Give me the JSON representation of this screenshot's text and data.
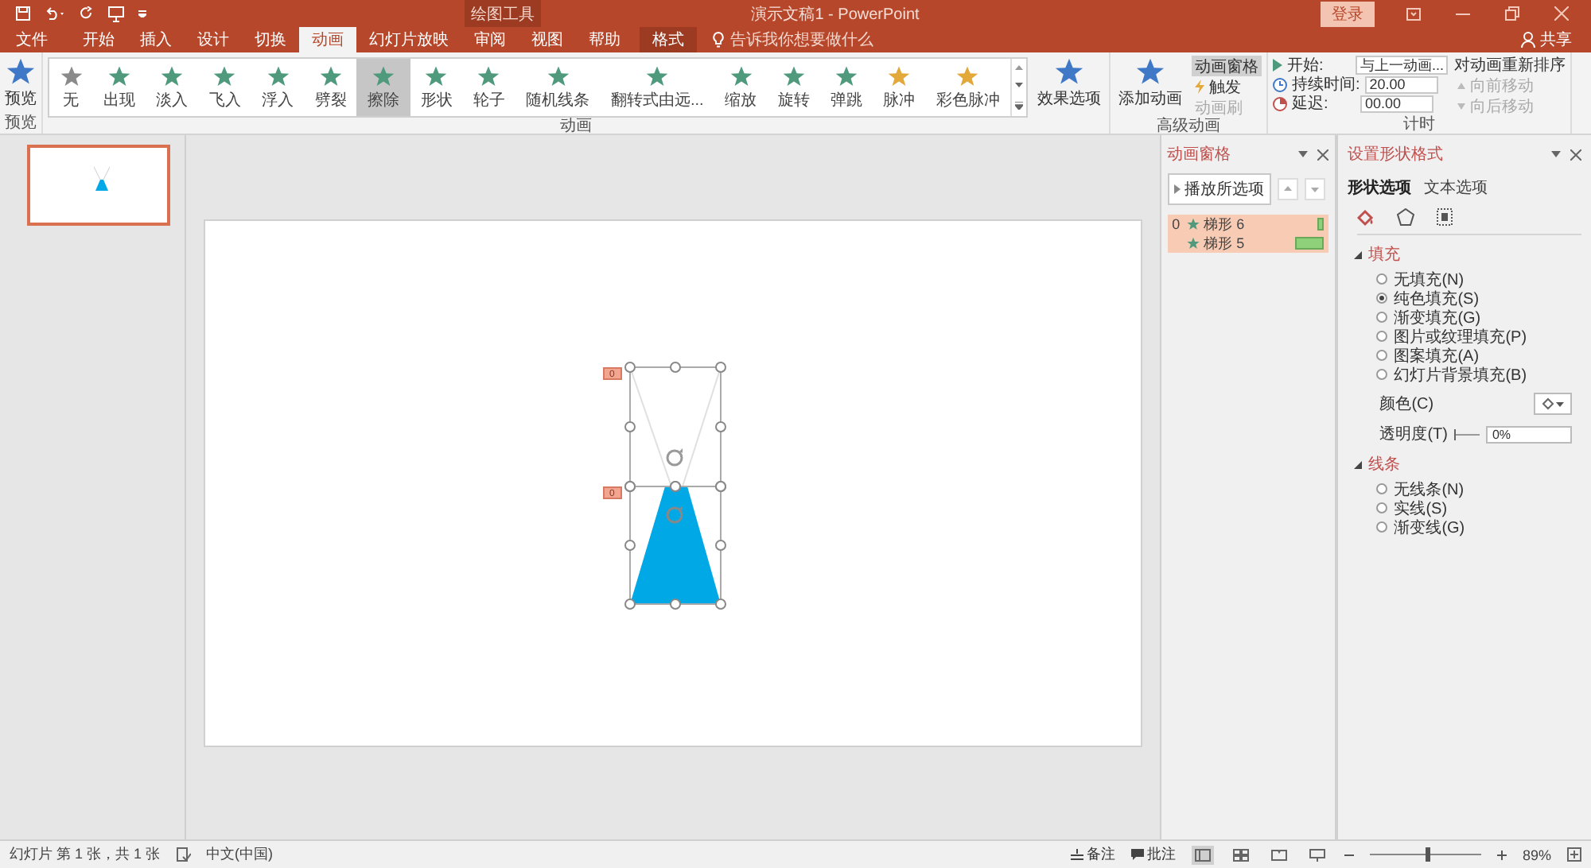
{
  "title_bar": {
    "context_label": "绘图工具",
    "title": "演示文稿1  -  PowerPoint",
    "sign_in": "登录"
  },
  "tabs": [
    {
      "label": "文件",
      "selected": false,
      "kind": "plain"
    },
    {
      "label": "开始",
      "selected": false,
      "kind": "plain"
    },
    {
      "label": "插入",
      "selected": false,
      "kind": "plain"
    },
    {
      "label": "设计",
      "selected": false,
      "kind": "plain"
    },
    {
      "label": "切换",
      "selected": false,
      "kind": "plain"
    },
    {
      "label": "动画",
      "selected": true,
      "kind": "plain"
    },
    {
      "label": "幻灯片放映",
      "selected": false,
      "kind": "plain"
    },
    {
      "label": "审阅",
      "selected": false,
      "kind": "plain"
    },
    {
      "label": "视图",
      "selected": false,
      "kind": "plain"
    },
    {
      "label": "帮助",
      "selected": false,
      "kind": "plain"
    },
    {
      "label": "格式",
      "selected": false,
      "kind": "context"
    }
  ],
  "tell_me": "告诉我你想要做什么",
  "share": "共享",
  "ribbon": {
    "preview": {
      "label": "预览",
      "group": "预览"
    },
    "gallery": {
      "group": "动画",
      "items": [
        {
          "label": "无",
          "kind": "none",
          "selected": false
        },
        {
          "label": "出现",
          "kind": "entrance",
          "selected": false
        },
        {
          "label": "淡入",
          "kind": "entrance",
          "selected": false
        },
        {
          "label": "飞入",
          "kind": "entrance",
          "selected": false
        },
        {
          "label": "浮入",
          "kind": "entrance",
          "selected": false
        },
        {
          "label": "劈裂",
          "kind": "entrance",
          "selected": false
        },
        {
          "label": "擦除",
          "kind": "entrance",
          "selected": true
        },
        {
          "label": "形状",
          "kind": "entrance",
          "selected": false
        },
        {
          "label": "轮子",
          "kind": "entrance",
          "selected": false
        },
        {
          "label": "随机线条",
          "kind": "entrance",
          "selected": false
        },
        {
          "label": "翻转式由远...",
          "kind": "entrance",
          "selected": false
        },
        {
          "label": "缩放",
          "kind": "entrance",
          "selected": false
        },
        {
          "label": "旋转",
          "kind": "entrance",
          "selected": false
        },
        {
          "label": "弹跳",
          "kind": "entrance",
          "selected": false
        },
        {
          "label": "脉冲",
          "kind": "emphasis",
          "selected": false
        },
        {
          "label": "彩色脉冲",
          "kind": "emphasis",
          "selected": false
        }
      ]
    },
    "effect_options": "效果选项",
    "advanced": {
      "group": "高级动画",
      "add_animation": "添加动画",
      "pane": {
        "label": "动画窗格",
        "selected": true
      },
      "trigger": "触发",
      "painter": {
        "label": "动画刷",
        "disabled": true
      }
    },
    "timing": {
      "group": "计时",
      "start_label": "开始:",
      "start_value": "与上一动画...",
      "duration_label": "持续时间:",
      "duration_value": "20.00",
      "delay_label": "延迟:",
      "delay_value": "00.00",
      "reorder": "对动画重新排序",
      "move_earlier": {
        "label": "向前移动",
        "disabled": true
      },
      "move_later": {
        "label": "向后移动",
        "disabled": true
      }
    }
  },
  "slide": {
    "tags": [
      "0",
      "0"
    ]
  },
  "animation_pane": {
    "title": "动画窗格",
    "play": "播放所选项",
    "items": [
      {
        "index": "0",
        "name": "梯形 6",
        "selected": true
      },
      {
        "name": "梯形 5",
        "selected": true
      }
    ]
  },
  "format_pane": {
    "title": "设置形状格式",
    "tabs": [
      {
        "label": "形状选项",
        "selected": true
      },
      {
        "label": "文本选项",
        "selected": false
      }
    ],
    "fill": {
      "title": "填充",
      "expanded": true,
      "options": [
        {
          "label": "无填充(N)",
          "selected": false
        },
        {
          "label": "纯色填充(S)",
          "selected": true
        },
        {
          "label": "渐变填充(G)",
          "selected": false
        },
        {
          "label": "图片或纹理填充(P)",
          "selected": false
        },
        {
          "label": "图案填充(A)",
          "selected": false
        },
        {
          "label": "幻灯片背景填充(B)",
          "selected": false
        }
      ],
      "color_label": "颜色(C)",
      "transparency_label": "透明度(T)",
      "transparency_slider": {
        "level": 0
      },
      "transparency_value": "0%"
    },
    "line": {
      "title": "线条",
      "expanded": true,
      "options": [
        {
          "label": "无线条(N)",
          "selected": false
        },
        {
          "label": "实线(S)",
          "selected": false
        },
        {
          "label": "渐变线(G)",
          "selected": false
        }
      ]
    }
  },
  "status_bar": {
    "slide_info": "幻灯片 第 1 张，共 1 张",
    "language": "中文(中国)",
    "notes": "备注",
    "comments": "批注",
    "zoom": "89%",
    "zoom_level": {
      "level": 0.5
    }
  }
}
